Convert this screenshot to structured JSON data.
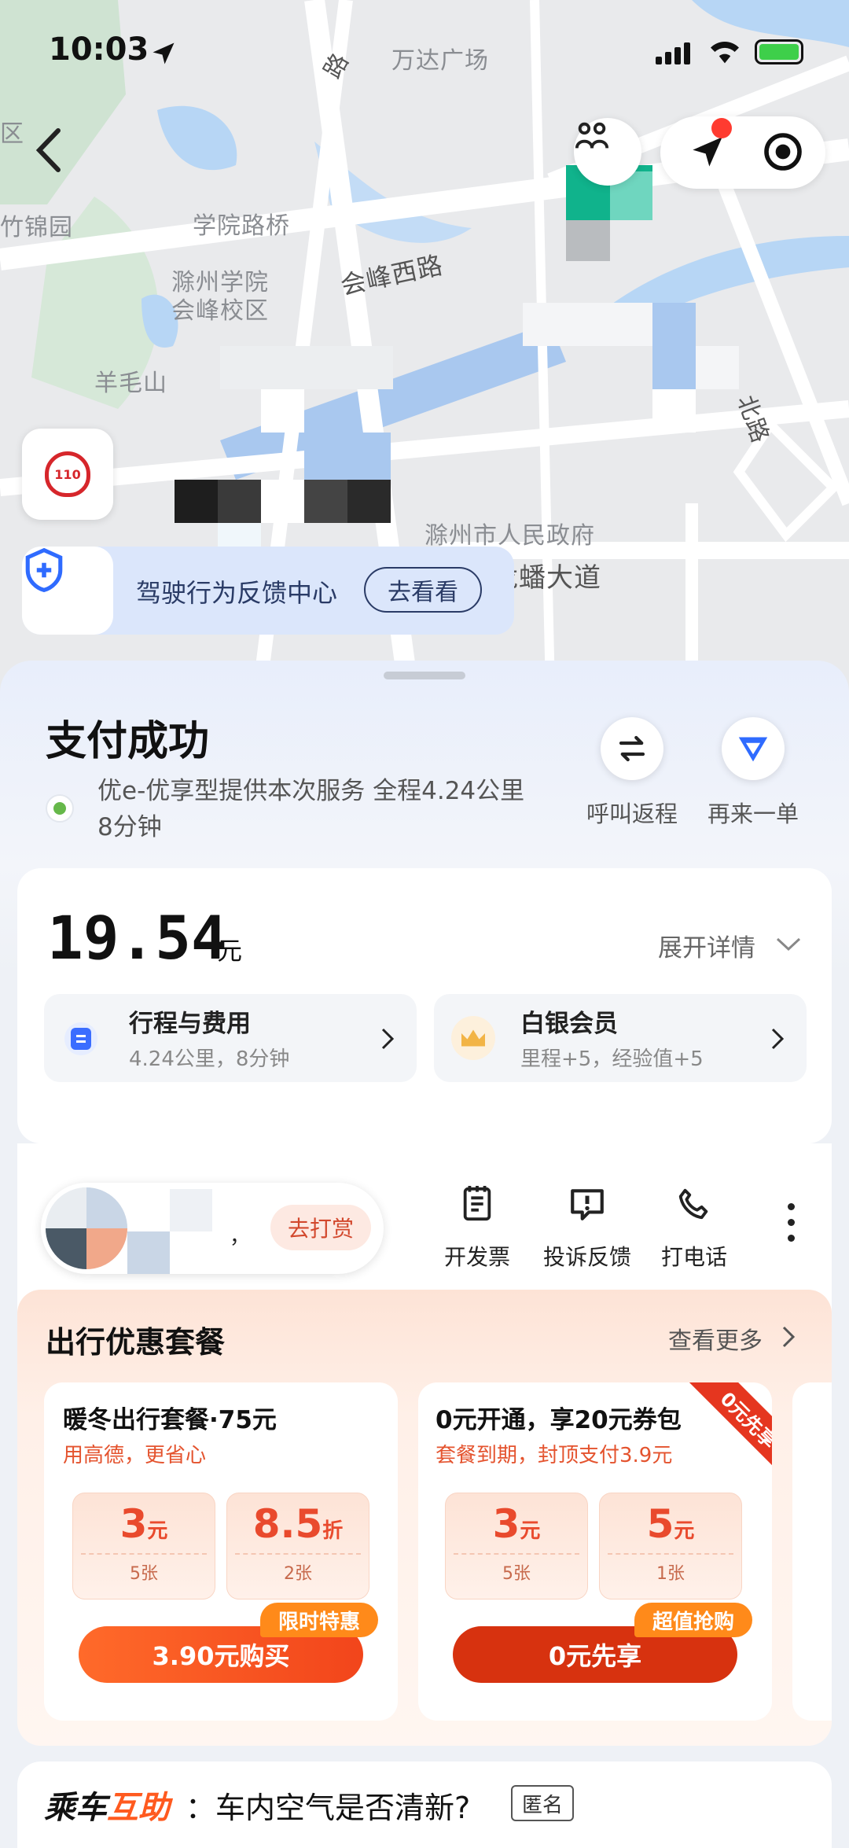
{
  "status_bar": {
    "time": "10:03"
  },
  "map": {
    "labels": [
      "万达广场",
      "学院路桥",
      "会峰西路",
      "滁州学院",
      "会峰校区",
      "羊毛山",
      "竹锦园",
      "滁州市人民政府",
      "龙蟠大道",
      "路",
      "区",
      "北路"
    ],
    "police_badge_text": "110",
    "feedback_banner": {
      "text": "驾驶行为反馈中心",
      "button": "去看看"
    }
  },
  "trip": {
    "title": "支付成功",
    "provider_line1": "优e-优享型提供本次服务 全程4.24公里",
    "provider_line2": "8分钟",
    "return_label": "呼叫返程",
    "again_label": "再来一单"
  },
  "payment": {
    "amount": "19.54",
    "unit": "元",
    "expand_label": "展开详情",
    "trip_fee": {
      "title": "行程与费用",
      "detail": "4.24公里，8分钟"
    },
    "membership": {
      "title": "白银会员",
      "detail": "里程+5，经验值+5"
    }
  },
  "driver": {
    "tip_label": "去打赏",
    "comma": "，"
  },
  "actions": [
    {
      "label": "开发票",
      "icon": "invoice-icon"
    },
    {
      "label": "投诉反馈",
      "icon": "complaint-icon"
    },
    {
      "label": "打电话",
      "icon": "phone-icon"
    }
  ],
  "packages": {
    "title": "出行优惠套餐",
    "more_label": "查看更多",
    "items": [
      {
        "title": "暖冬出行套餐·75元",
        "subtitle": "用高德，更省心",
        "coupons": [
          {
            "value": "3",
            "unit": "元",
            "count": "5张"
          },
          {
            "value": "8.5",
            "unit": "折",
            "count": "2张"
          }
        ],
        "tag": "限时特惠",
        "button": "3.90元购买"
      },
      {
        "title": "0元开通，享20元券包",
        "subtitle": "套餐到期，封顶支付3.9元",
        "ribbon": "0元先享",
        "coupons": [
          {
            "value": "3",
            "unit": "元",
            "count": "5张"
          },
          {
            "value": "5",
            "unit": "元",
            "count": "1张"
          }
        ],
        "tag": "超值抢购",
        "button": "0元先享"
      }
    ]
  },
  "community": {
    "prefix": "乘车",
    "highlight": "互助",
    "question": "：车内空气是否清新?",
    "badge": "匿名"
  },
  "colors": {
    "accent_blue": "#2f6bff",
    "orange": "#ff5a1f",
    "dark_red": "#d7320f"
  }
}
